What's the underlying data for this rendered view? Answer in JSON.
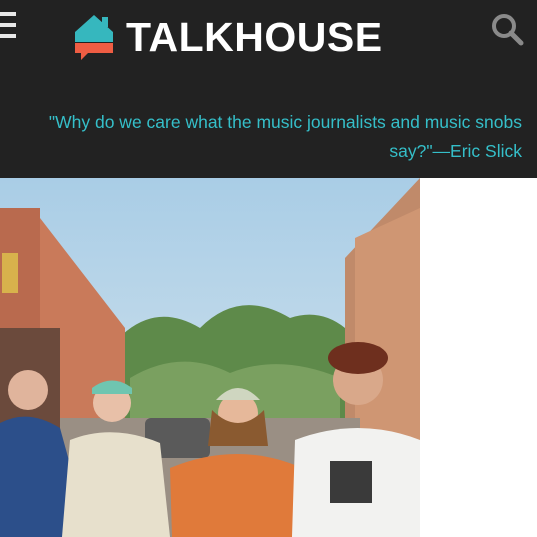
{
  "header": {
    "brand": "TALKHOUSE",
    "menu_icon": "hamburger-menu-icon",
    "search_icon": "search-icon",
    "colors": {
      "background": "#222222",
      "accent": "#35bfc9",
      "logo_roof": "#36b7be",
      "logo_base": "#ef5d43"
    }
  },
  "article": {
    "pull_quote": "\"Why do we care what the music journalists and music snobs say?\"—Eric Slick"
  },
  "hero_image": {
    "description": "Band photo of five men standing in an alley between buildings"
  }
}
